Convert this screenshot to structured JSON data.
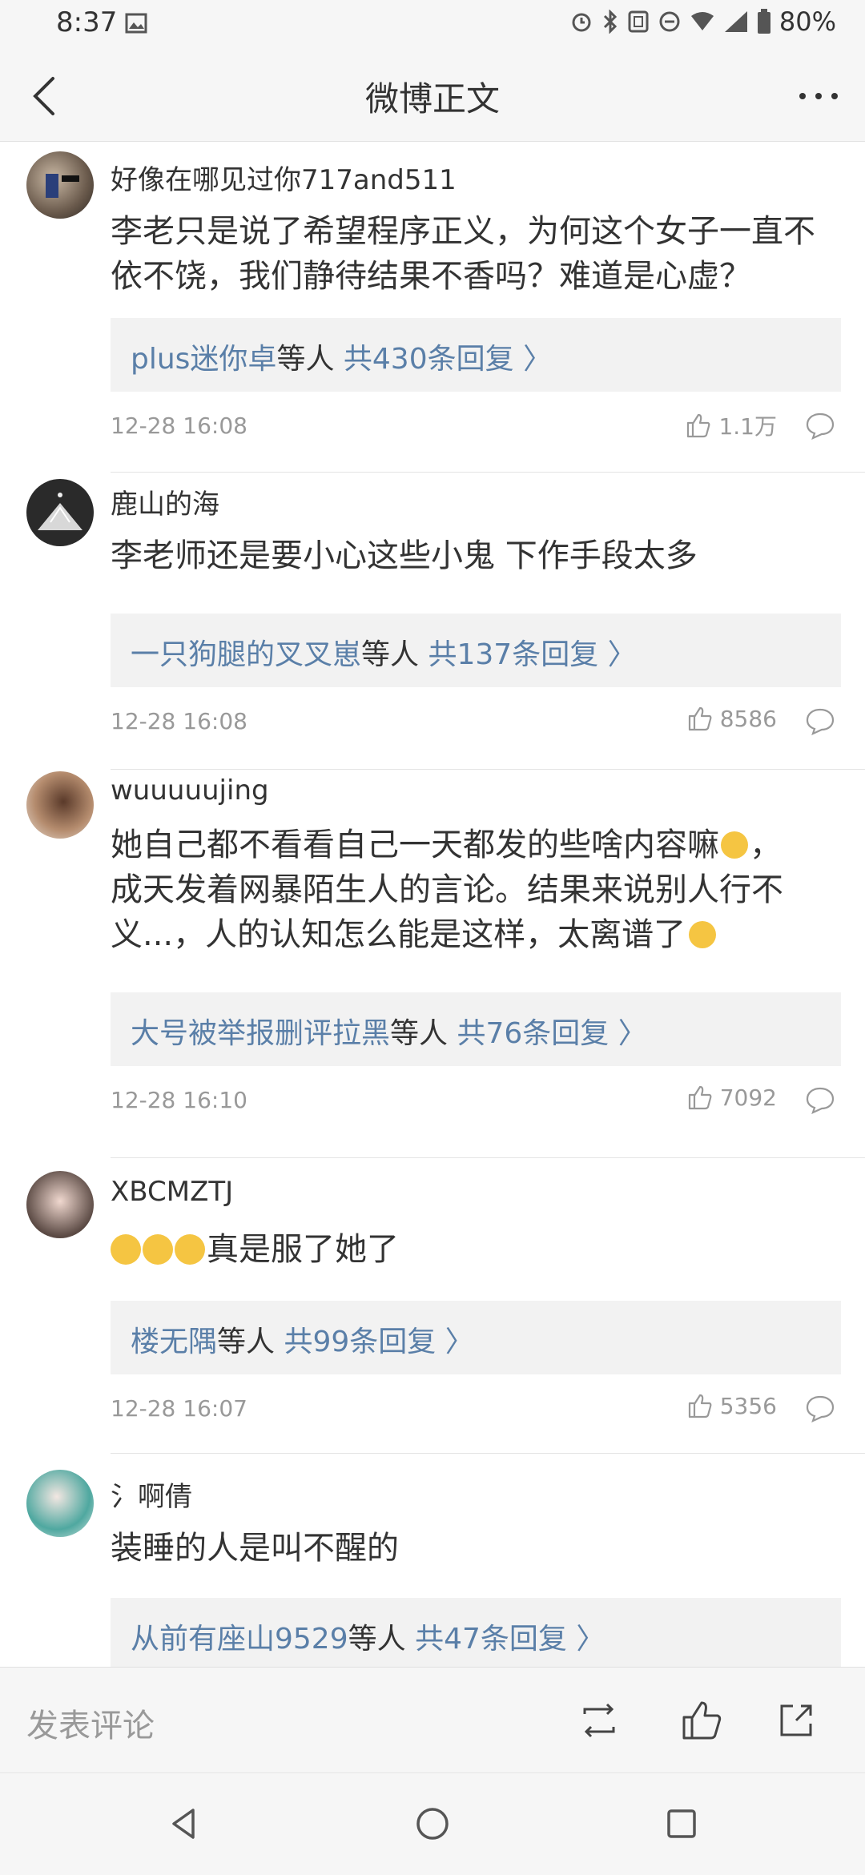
{
  "status_bar": {
    "time": "8:37",
    "battery": "80%"
  },
  "header": {
    "title": "微博正文"
  },
  "comments": [
    {
      "username": "好像在哪见过你717and511",
      "text": "李老只是说了希望程序正义，为何这个女子一直不依不饶，我们静待结果不香吗？难道是心虚？",
      "reply_from": "plus迷你卓",
      "reply_mid": "等人",
      "reply_count": "共430条回复 〉",
      "time": "12-28 16:08",
      "likes": "1.1万"
    },
    {
      "username": "鹿山的海",
      "text": "李老师还是要小心这些小鬼 下作手段太多",
      "reply_from": "一只狗腿的叉叉崽",
      "reply_mid": "等人",
      "reply_count": "共137条回复 〉",
      "time": "12-28 16:08",
      "likes": "8586"
    },
    {
      "username": "wuuuuujing",
      "text_line1": "她自己都不看看自己一天都发的些啥内容嘛",
      "text_line1b": "，",
      "text_line2": "成天发着网暴陌生人的言论。结果来说别人行不",
      "text_line3": "义...，人的认知怎么能是这样，太离谱了",
      "reply_from": "大号被举报删评拉黑",
      "reply_mid": "等人",
      "reply_count": "共76条回复 〉",
      "time": "12-28 16:10",
      "likes": "7092"
    },
    {
      "username": "XBCMZTJ",
      "text": "真是服了她了",
      "reply_from": "楼无隅",
      "reply_mid": "等人",
      "reply_count": "共99条回复 〉",
      "time": "12-28 16:07",
      "likes": "5356"
    },
    {
      "username": "氵啊倩",
      "text": "装睡的人是叫不醒的",
      "reply_from": "从前有座山9529",
      "reply_mid": "等人",
      "reply_count": "共47条回复 〉"
    }
  ],
  "bottom_bar": {
    "placeholder": "发表评论"
  },
  "colors": {
    "link_blue": "#5a7fa8",
    "background": "#f6f6f6",
    "reply_box": "#f2f2f2"
  }
}
